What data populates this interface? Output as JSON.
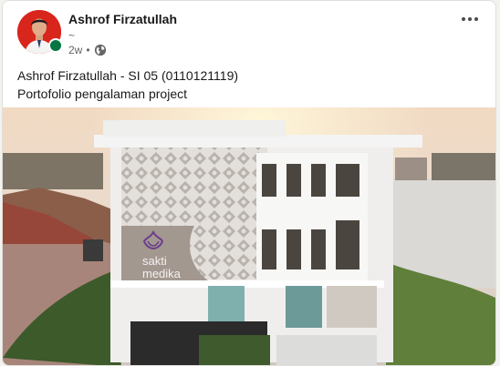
{
  "post": {
    "author_name": "Ashrof Firzatullah",
    "author_headline": "~",
    "time_ago": "2w",
    "separator": "•",
    "visibility_icon": "globe-icon",
    "more_icon": "more-horizontal-icon",
    "text_line_1": "Ashrof Firzatullah - SI 05 (0110121119)",
    "text_line_2": "Portofolio pengalaman project",
    "image": {
      "subject": "building",
      "sign_word_1": "sakti",
      "sign_word_2": "medika"
    }
  },
  "colors": {
    "presence": "#057642",
    "avatar_background": "#d8261d",
    "logo_purple": "#6d3f8c"
  }
}
